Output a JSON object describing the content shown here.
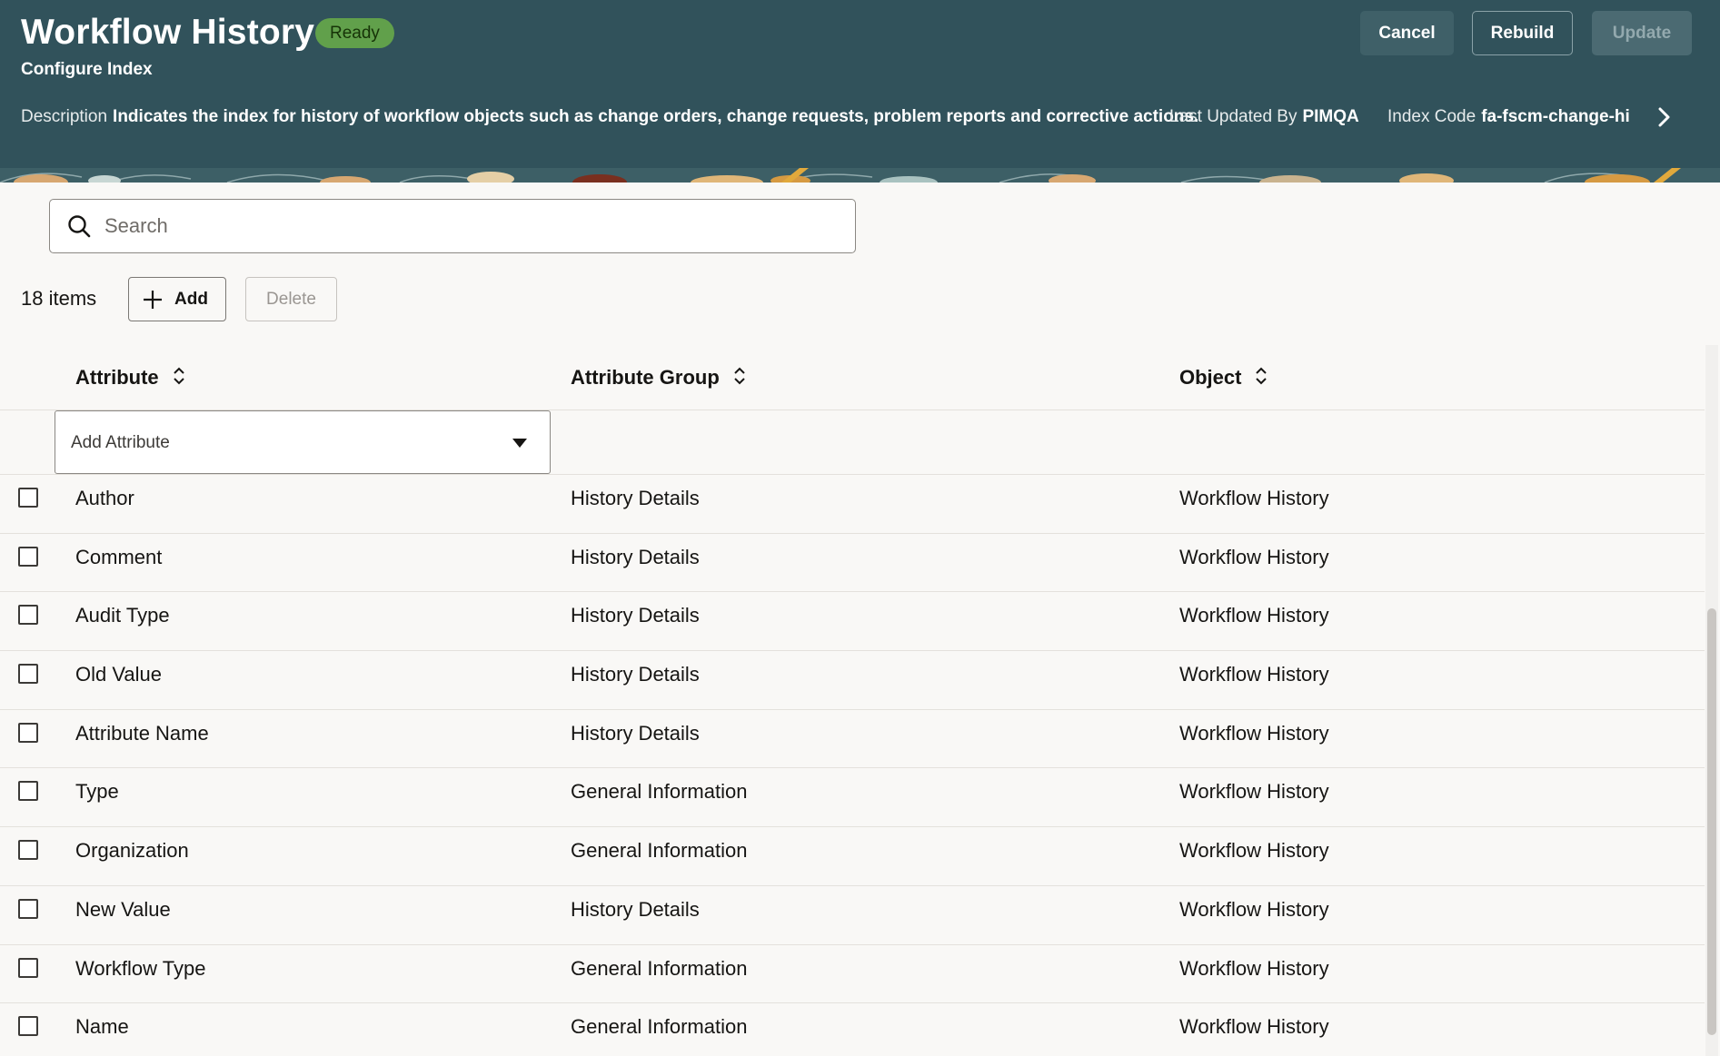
{
  "header": {
    "title": "Workflow History",
    "status": "Ready",
    "subtitle": "Configure Index",
    "buttons": {
      "cancel": "Cancel",
      "rebuild": "Rebuild",
      "update": "Update"
    },
    "description_label": "Description",
    "description_value": "Indicates the index for history of workflow objects such as change orders, change requests, problem reports and corrective actions.",
    "last_updated_label": "Last Updated By",
    "last_updated_value": "PIMQA",
    "index_code_label": "Index Code",
    "index_code_value": "fa-fscm-change-hi"
  },
  "search": {
    "placeholder": "Search"
  },
  "toolbar": {
    "count": "18 items",
    "add_label": "Add",
    "delete_label": "Delete"
  },
  "table": {
    "columns": [
      "Attribute",
      "Attribute Group",
      "Object"
    ],
    "add_attribute": "Add Attribute",
    "rows": [
      [
        "Author",
        "History Details",
        "Workflow History"
      ],
      [
        "Comment",
        "History Details",
        "Workflow History"
      ],
      [
        "Audit Type",
        "History Details",
        "Workflow History"
      ],
      [
        "Old Value",
        "History Details",
        "Workflow History"
      ],
      [
        "Attribute Name",
        "History Details",
        "Workflow History"
      ],
      [
        "Type",
        "General Information",
        "Workflow History"
      ],
      [
        "Organization",
        "General Information",
        "Workflow History"
      ],
      [
        "New Value",
        "History Details",
        "Workflow History"
      ],
      [
        "Workflow Type",
        "General Information",
        "Workflow History"
      ],
      [
        "Name",
        "General Information",
        "Workflow History"
      ]
    ]
  },
  "colors": {
    "header_bg": "#31525b",
    "status_bg": "#61a04b",
    "page_bg": "#f9f8f6"
  }
}
